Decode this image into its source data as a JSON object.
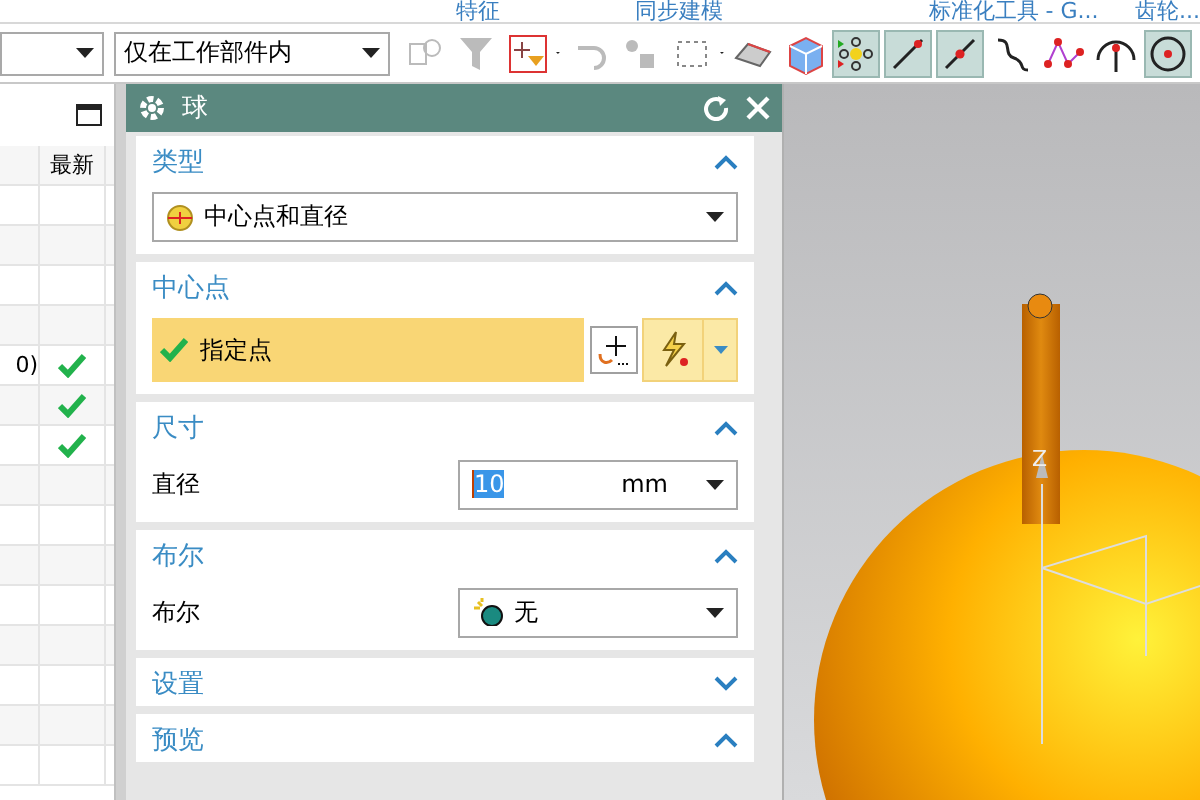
{
  "ribbon_groups": [
    "特征",
    "同步建模",
    "标准化工具 - G...",
    "齿轮..."
  ],
  "toolbar": {
    "filter_value": "仅在工作部件内",
    "tools": [
      {
        "selected": false
      },
      {
        "selected": false
      },
      {
        "selected": false
      },
      {
        "selected": false
      },
      {
        "selected": false
      },
      {
        "selected": false
      },
      {
        "selected": false
      },
      {
        "selected": false
      },
      {
        "selected": true
      },
      {
        "selected": true
      },
      {
        "selected": true
      },
      {
        "selected": false
      },
      {
        "selected": false
      },
      {
        "selected": false
      },
      {
        "selected": true
      }
    ]
  },
  "navigator": {
    "columns": [
      "最新"
    ],
    "rows": [
      {
        "latest": false
      },
      {
        "latest": false
      },
      {
        "latest": false
      },
      {
        "latest": false
      },
      {
        "text": "0)",
        "latest": true
      },
      {
        "latest": true
      },
      {
        "latest": true
      },
      {
        "latest": false
      },
      {
        "latest": false
      },
      {
        "latest": false
      },
      {
        "latest": false
      },
      {
        "latest": false
      },
      {
        "latest": false
      },
      {
        "latest": false
      },
      {
        "latest": false
      }
    ]
  },
  "dialog": {
    "title": "球",
    "sections": [
      {
        "kind": "dropdown",
        "title": "类型",
        "expanded": true,
        "value": "中心点和直径"
      },
      {
        "kind": "point",
        "title": "中心点",
        "expanded": true,
        "label": "指定点",
        "checked": true
      },
      {
        "kind": "measure",
        "title": "尺寸",
        "expanded": true,
        "label": "直径",
        "value": "10",
        "unit": "mm"
      },
      {
        "kind": "select",
        "title": "布尔",
        "expanded": true,
        "label": "布尔",
        "value": "无"
      },
      {
        "kind": "empty",
        "title": "设置",
        "expanded": false
      },
      {
        "kind": "empty",
        "title": "预览",
        "expanded": true
      }
    ]
  },
  "viewport": {
    "axis_label": "Z"
  }
}
